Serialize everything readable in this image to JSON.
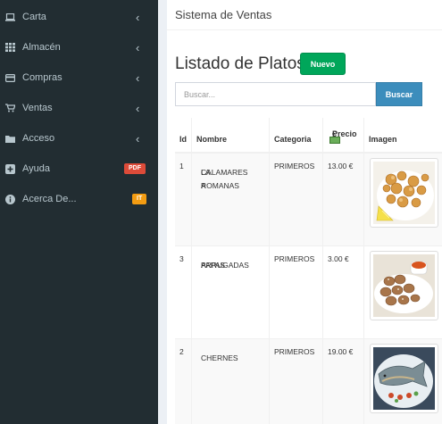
{
  "sidebar": {
    "items": [
      {
        "label": "Carta",
        "icon": "laptop-icon",
        "chevron": "‹"
      },
      {
        "label": "Almacén",
        "icon": "grid-icon",
        "chevron": "‹"
      },
      {
        "label": "Compras",
        "icon": "credit-card-icon",
        "chevron": "‹"
      },
      {
        "label": "Ventas",
        "icon": "shopping-cart-icon",
        "chevron": "‹"
      },
      {
        "label": "Acceso",
        "icon": "folder-icon",
        "chevron": "‹"
      },
      {
        "label": "Ayuda",
        "icon": "plus-square-icon",
        "badge": "PDF"
      },
      {
        "label": "Acerca De...",
        "icon": "info-circle-icon",
        "badge": "IT"
      }
    ]
  },
  "header": {
    "title": "Sistema de Ventas"
  },
  "main": {
    "heading": "Listado de Platos",
    "new_button": "Nuevo",
    "search_placeholder": "Buscar...",
    "search_button": "Buscar"
  },
  "table": {
    "headers": {
      "id": "Id",
      "nombre": "Nombre",
      "categoria": "Categoria",
      "precio_line1": "Precio",
      "precio_line2": "€",
      "imagen": "Imagen"
    },
    "rows": [
      {
        "id": "1",
        "nombre_l1": "CALAMARES A",
        "nombre_l2": "LA ROMANAS",
        "categoria": "PRIMEROS",
        "precio": "13.00 €",
        "image": "fried-calamari"
      },
      {
        "id": "3",
        "nombre_l1": "PAPAS",
        "nombre_l2": "ARRUGADAS",
        "categoria": "PRIMEROS",
        "precio": "3.00 €",
        "image": "wrinkled-potatoes"
      },
      {
        "id": "2",
        "nombre_l1": "CHERNES",
        "nombre_l2": "",
        "categoria": "PRIMEROS",
        "precio": "19.00 €",
        "image": "fish-plate"
      }
    ]
  },
  "colors": {
    "sidebar_bg": "#222d32",
    "sidebar_text": "#b8c7ce",
    "success": "#00a65a",
    "primary": "#3c8dbc",
    "danger": "#dd4b39",
    "warning": "#f39c12"
  }
}
